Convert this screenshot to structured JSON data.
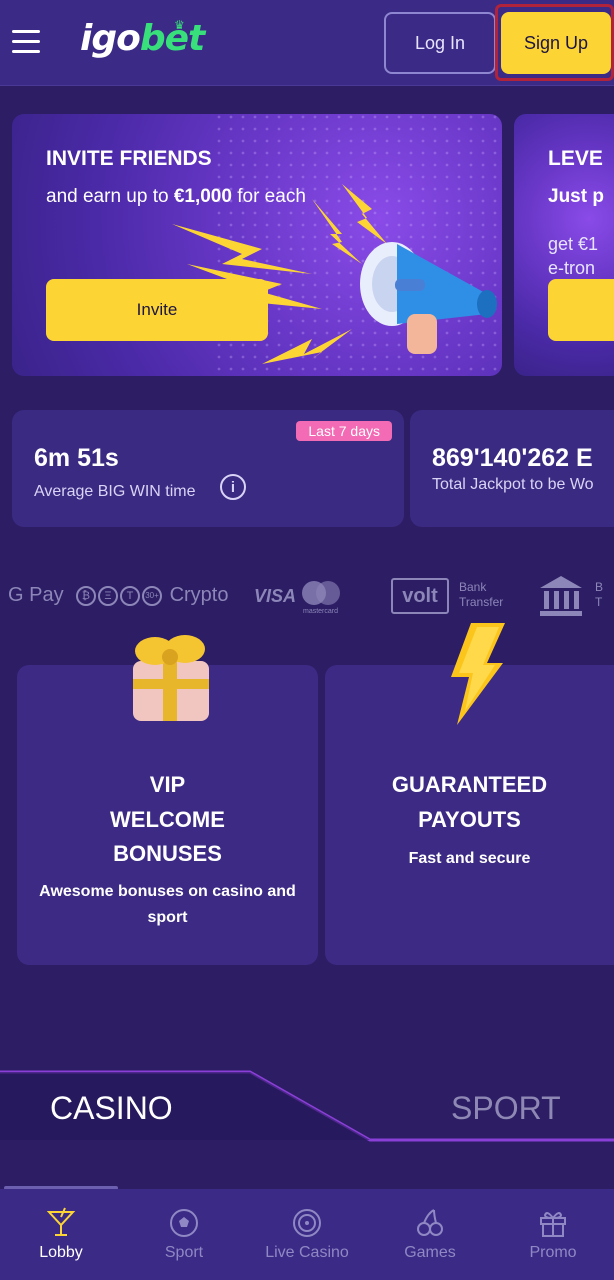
{
  "header": {
    "menu_icon": "hamburger-icon",
    "logo": {
      "part1": "igo",
      "part2": "bet"
    },
    "login_label": "Log In",
    "signup_label": "Sign Up"
  },
  "promos": [
    {
      "title": "INVITE FRIENDS",
      "subtitle_prefix": "and earn up to ",
      "subtitle_amount": "€1,000",
      "subtitle_suffix": " for each",
      "button_label": "Invite",
      "image_icon": "megaphone-icon"
    },
    {
      "title": "LEVE",
      "subtitle": "Just p",
      "text": "get €1\ne-tron"
    }
  ],
  "stats": [
    {
      "badge": "Last 7 days",
      "value": "6m 51s",
      "label": "Average BIG WIN time",
      "info_icon": "info-icon"
    },
    {
      "value": "869'140'262 E",
      "label": "Total Jackpot to be Wo"
    }
  ],
  "payments": {
    "gpay": "G Pay",
    "crypto_more": "30+",
    "crypto": "Crypto",
    "visa": "VISA",
    "mastercard": "mastercard",
    "volt": "volt",
    "bank_transfer_1": "Bank",
    "bank_transfer_2": "Transfer",
    "bank_2_line1": "B",
    "bank_2_line2": "T"
  },
  "features": [
    {
      "icon": "gift-icon",
      "title": "VIP\nWELCOME\nBONUSES",
      "desc": "Awesome bonuses on casino and sport"
    },
    {
      "icon": "lightning-icon",
      "title": "GUARANTEED\nPAYOUTS",
      "desc": "Fast and secure"
    }
  ],
  "switcher": {
    "casino": "CASINO",
    "sport": "SPORT",
    "active": "casino"
  },
  "bottom_nav": [
    {
      "label": "Lobby",
      "icon": "cocktail-icon",
      "active": true
    },
    {
      "label": "Sport",
      "icon": "soccer-ball-icon",
      "active": false
    },
    {
      "label": "Live Casino",
      "icon": "roulette-icon",
      "active": false
    },
    {
      "label": "Games",
      "icon": "cherries-icon",
      "active": false
    },
    {
      "label": "Promo",
      "icon": "gift-box-icon",
      "active": false
    }
  ],
  "colors": {
    "background": "#2c1d64",
    "header": "#3b2a86",
    "accent_yellow": "#fcd535",
    "accent_green": "#37e07a",
    "badge_pink": "#f26bb4",
    "highlight_red": "#b0233a"
  }
}
